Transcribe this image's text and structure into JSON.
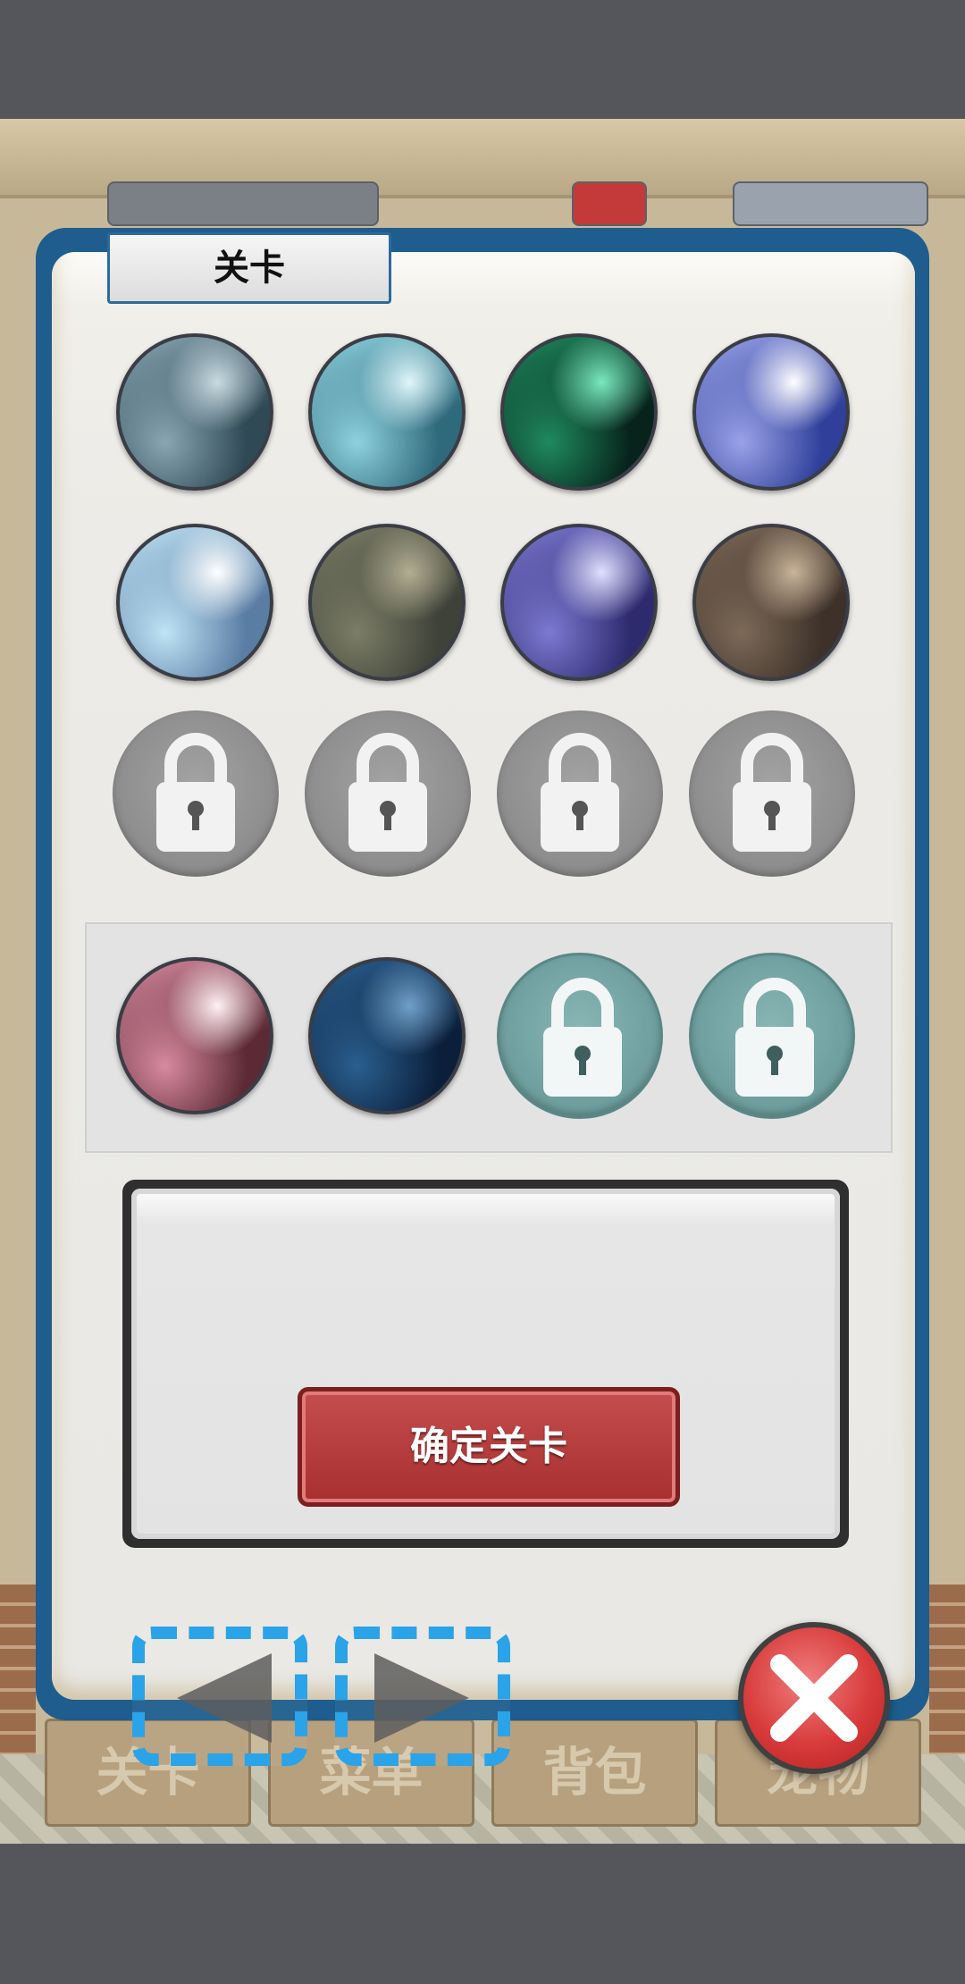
{
  "dialog": {
    "title": "关卡",
    "confirm_label": "确定关卡"
  },
  "levels": {
    "row1": [
      {
        "name": "swamp-forest",
        "unlocked": true,
        "colors": [
          "#2f4a55",
          "#8aa6b4",
          "#c9dbe2"
        ]
      },
      {
        "name": "ice-cave",
        "unlocked": true,
        "colors": [
          "#2f6a7c",
          "#8fd2de",
          "#e0f7fb"
        ]
      },
      {
        "name": "emerald-forest",
        "unlocked": true,
        "colors": [
          "#07231c",
          "#1f8a5e",
          "#7ae8bf"
        ]
      },
      {
        "name": "waterfall-sun",
        "unlocked": true,
        "colors": [
          "#2f3f9a",
          "#9aa3e8",
          "#ffffff"
        ]
      }
    ],
    "row2": [
      {
        "name": "ice-castle",
        "unlocked": true,
        "colors": [
          "#5a7da4",
          "#bfe4f5",
          "#ffffff"
        ]
      },
      {
        "name": "stone-relief",
        "unlocked": true,
        "colors": [
          "#3e4238",
          "#7c7d67",
          "#b3ae92"
        ]
      },
      {
        "name": "violet-hall",
        "unlocked": true,
        "colors": [
          "#2e2a6e",
          "#7c7ad2",
          "#dfe0ff"
        ]
      },
      {
        "name": "owl-library",
        "unlocked": true,
        "colors": [
          "#3d3129",
          "#7d6a58",
          "#c9b49a"
        ]
      }
    ],
    "row3_locked_count": 4
  },
  "event_levels": [
    {
      "name": "pink-throne",
      "unlocked": true,
      "colors": [
        "#5c2a35",
        "#d88aa0",
        "#fff1f4"
      ]
    },
    {
      "name": "blue-ruins",
      "unlocked": true,
      "colors": [
        "#0b1f3b",
        "#2a5f8f",
        "#6fa0c9"
      ]
    },
    {
      "name": "locked-teal-1",
      "unlocked": false
    },
    {
      "name": "locked-teal-2",
      "unlocked": false
    }
  ],
  "nav": {
    "prev_icon": "triangle-left-icon",
    "next_icon": "triangle-right-icon",
    "close_icon": "x-icon"
  },
  "background": {
    "tabs": [
      "关卡",
      "菜单",
      "背包",
      "宠物"
    ]
  }
}
